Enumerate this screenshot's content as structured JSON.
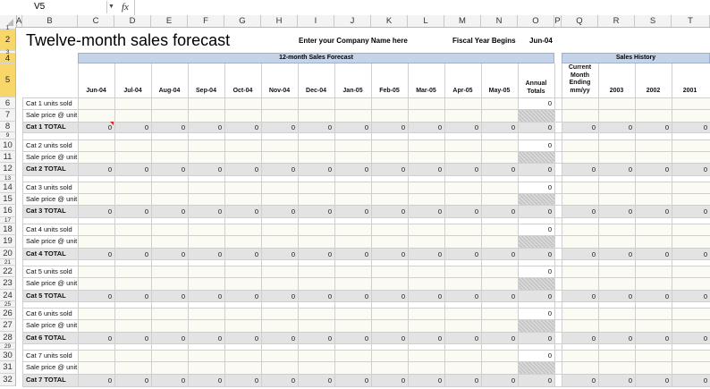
{
  "formula_bar": {
    "name_box": "V5",
    "fx_symbol": "fx",
    "formula": ""
  },
  "columns": [
    "A",
    "B",
    "C",
    "D",
    "E",
    "F",
    "G",
    "H",
    "I",
    "J",
    "K",
    "L",
    "M",
    "N",
    "O",
    "P",
    "Q",
    "R",
    "S",
    "T"
  ],
  "rows": [
    "1",
    "2",
    "3",
    "4",
    "5",
    "6",
    "7",
    "8",
    "9",
    "10",
    "11",
    "12",
    "13",
    "14",
    "15",
    "16",
    "17",
    "18",
    "19",
    "20",
    "21",
    "22",
    "23",
    "24",
    "25",
    "26",
    "27",
    "28",
    "29",
    "30",
    "31",
    "32"
  ],
  "sheet": {
    "title": "Twelve-month sales forecast",
    "company": "Enter your Company Name here",
    "fiscal_label": "Fiscal Year Begins",
    "fiscal_value": "Jun-04",
    "forecast_header": "12-month  Sales Forecast",
    "history_header": "Sales History",
    "months": [
      "Jun-04",
      "Jul-04",
      "Aug-04",
      "Sep-04",
      "Oct-04",
      "Nov-04",
      "Dec-04",
      "Jan-05",
      "Feb-05",
      "Mar-05",
      "Apr-05",
      "May-05"
    ],
    "annual_totals": "Annual Totals",
    "history_cols": [
      "Current Month Ending mm/yy",
      "2003",
      "2002",
      "2001"
    ],
    "categories": [
      {
        "units": "Cat 1 units sold",
        "price": "Sale price @ unit",
        "total": "Cat 1 TOTAL"
      },
      {
        "units": "Cat 2 units sold",
        "price": "Sale price @ unit",
        "total": "Cat 2 TOTAL"
      },
      {
        "units": "Cat 3 units sold",
        "price": "Sale price @ unit",
        "total": "Cat 3 TOTAL"
      },
      {
        "units": "Cat 4 units sold",
        "price": "Sale price @ unit",
        "total": "Cat 4 TOTAL"
      },
      {
        "units": "Cat 5 units sold",
        "price": "Sale price @ unit",
        "total": "Cat 5 TOTAL"
      },
      {
        "units": "Cat 6 units sold",
        "price": "Sale price @ unit",
        "total": "Cat 6 TOTAL"
      },
      {
        "units": "Cat 7 units sold",
        "price": "Sale price @ unit",
        "total": "Cat 7 TOTAL"
      }
    ],
    "zero": "0"
  },
  "colors": {
    "header_band": "#c5d3e8",
    "total_band": "#e3e3e3",
    "input_band": "#fbfbf3",
    "selected_row": "#f9d66a"
  }
}
